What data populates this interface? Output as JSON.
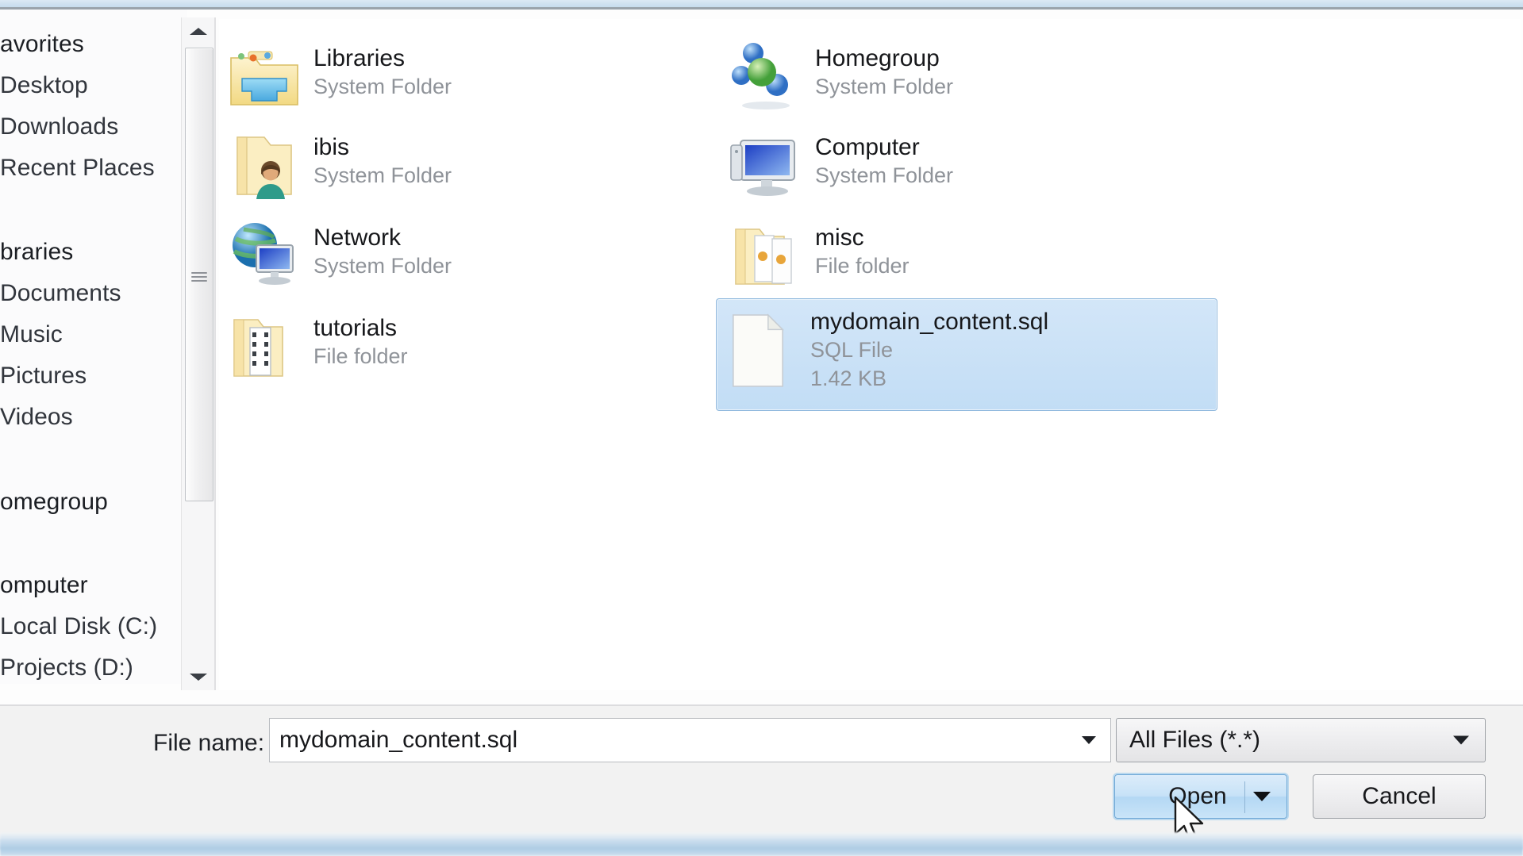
{
  "nav": {
    "groups": [
      {
        "header": "Favorites",
        "clipped_header": "avorites",
        "items": [
          "Desktop",
          "Downloads",
          "Recent Places"
        ]
      },
      {
        "header": "Libraries",
        "clipped_header": "braries",
        "items": [
          "Documents",
          "Music",
          "Pictures",
          "Videos"
        ]
      },
      {
        "header": "Homegroup",
        "clipped_header": "omegroup",
        "items": []
      },
      {
        "header": "Computer",
        "clipped_header": "omputer",
        "items": [
          "Local Disk (C:)",
          "Projects (D:)"
        ]
      }
    ],
    "scrollbar": {
      "up_arrow": "scroll-up",
      "down_arrow": "scroll-down"
    }
  },
  "files": {
    "columns": 2,
    "items": [
      {
        "name": "Libraries",
        "type": "System Folder",
        "size": "",
        "icon": "libraries-folder-icon",
        "selected": false
      },
      {
        "name": "Homegroup",
        "type": "System Folder",
        "size": "",
        "icon": "homegroup-icon",
        "selected": false
      },
      {
        "name": "ibis",
        "type": "System Folder",
        "size": "",
        "icon": "user-folder-icon",
        "selected": false
      },
      {
        "name": "Computer",
        "type": "System Folder",
        "size": "",
        "icon": "computer-icon",
        "selected": false
      },
      {
        "name": "Network",
        "type": "System Folder",
        "size": "",
        "icon": "network-icon",
        "selected": false
      },
      {
        "name": "misc",
        "type": "File folder",
        "size": "",
        "icon": "documents-folder-icon",
        "selected": false
      },
      {
        "name": "tutorials",
        "type": "File folder",
        "size": "",
        "icon": "film-folder-icon",
        "selected": false
      },
      {
        "name": "mydomain_content.sql",
        "type": "SQL File",
        "size": "1.42 KB",
        "icon": "blank-document-icon",
        "selected": true
      }
    ]
  },
  "bottom": {
    "filename_label": "File name:",
    "filename_value": "mydomain_content.sql",
    "filename_placeholder": "File name",
    "filter_value": "All Files (*.*)",
    "open_label": "Open",
    "cancel_label": "Cancel"
  },
  "colors": {
    "selection_fill": "#c2ddf5",
    "selection_border": "#8fb8dd",
    "open_button_fill": "#b4d8f4",
    "panel_bg": "#f2f2f2",
    "text": "#17181b",
    "muted_text": "#8f9399"
  }
}
